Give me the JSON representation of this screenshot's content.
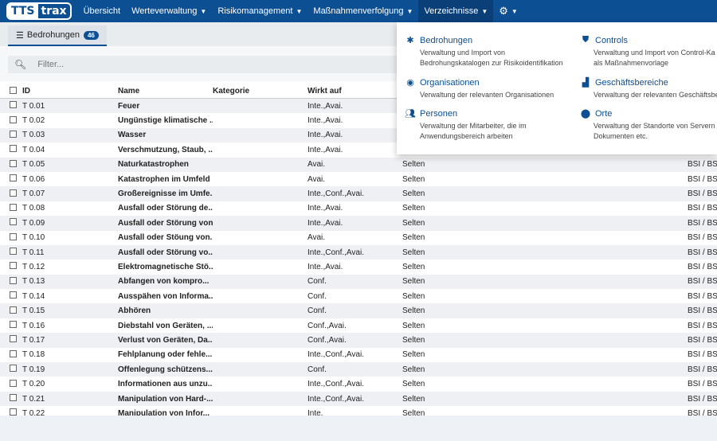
{
  "logo": {
    "part1": "TTS",
    "part2": "trax"
  },
  "nav": {
    "items": [
      {
        "label": "Übersicht",
        "caret": false
      },
      {
        "label": "Werteverwaltung",
        "caret": true
      },
      {
        "label": "Risikomanagement",
        "caret": true
      },
      {
        "label": "Maßnahmenverfolgung",
        "caret": true
      },
      {
        "label": "Verzeichnisse",
        "caret": true
      }
    ],
    "settings_icon": "gear-icon"
  },
  "tab": {
    "label": "Bedrohungen",
    "count": "46"
  },
  "filter": {
    "placeholder": "Filter..."
  },
  "table": {
    "headers": [
      "ID",
      "Name",
      "Kategorie",
      "Wirkt auf"
    ],
    "rows": [
      {
        "id": "T 0.01",
        "name": "Feuer",
        "wirkt": "Inte.,Avai.",
        "freq": "",
        "quelle": ""
      },
      {
        "id": "T 0.02",
        "name": "Ungünstige klimatische ...",
        "wirkt": "Inte.,Avai.",
        "freq": "",
        "quelle": ""
      },
      {
        "id": "T 0.03",
        "name": "Wasser",
        "wirkt": "Inte.,Avai.",
        "freq": "",
        "quelle": ""
      },
      {
        "id": "T 0.04",
        "name": "Verschmutzung, Staub, ...",
        "wirkt": "Inte.,Avai.",
        "freq": "",
        "quelle": ""
      },
      {
        "id": "T 0.05",
        "name": "Naturkatastrophen",
        "wirkt": "Avai.",
        "freq": "Selten",
        "quelle": "BSI / BSI"
      },
      {
        "id": "T 0.06",
        "name": "Katastrophen im Umfeld",
        "wirkt": "Avai.",
        "freq": "Selten",
        "quelle": "BSI / BSI"
      },
      {
        "id": "T 0.07",
        "name": "Großereignisse im Umfe...",
        "wirkt": "Inte.,Conf.,Avai.",
        "freq": "Selten",
        "quelle": "BSI / BSI"
      },
      {
        "id": "T 0.08",
        "name": "Ausfall oder Störung de...",
        "wirkt": "Inte.,Avai.",
        "freq": "Selten",
        "quelle": "BSI / BSI"
      },
      {
        "id": "T 0.09",
        "name": "Ausfall oder Störung von...",
        "wirkt": "Inte.,Avai.",
        "freq": "Selten",
        "quelle": "BSI / BSI"
      },
      {
        "id": "T 0.10",
        "name": "Ausfall oder Stöung von...",
        "wirkt": "Avai.",
        "freq": "Selten",
        "quelle": "BSI / BSI"
      },
      {
        "id": "T 0.11",
        "name": "Ausfall oder Störung vo...",
        "wirkt": "Inte.,Conf.,Avai.",
        "freq": "Selten",
        "quelle": "BSI / BSI"
      },
      {
        "id": "T 0.12",
        "name": "Elektromagnetische Stö...",
        "wirkt": "Inte.,Avai.",
        "freq": "Selten",
        "quelle": "BSI / BSI"
      },
      {
        "id": "T 0.13",
        "name": "Abfangen von kompro...",
        "wirkt": "Conf.",
        "freq": "Selten",
        "quelle": "BSI / BSI"
      },
      {
        "id": "T 0.14",
        "name": "Ausspähen von Informa...",
        "wirkt": "Conf.",
        "freq": "Selten",
        "quelle": "BSI / BSI"
      },
      {
        "id": "T 0.15",
        "name": "Abhören",
        "wirkt": "Conf.",
        "freq": "Selten",
        "quelle": "BSI / BSI"
      },
      {
        "id": "T 0.16",
        "name": "Diebstahl von Geräten, ...",
        "wirkt": "Conf.,Avai.",
        "freq": "Selten",
        "quelle": "BSI / BSI"
      },
      {
        "id": "T 0.17",
        "name": "Verlust von Geräten, Da...",
        "wirkt": "Conf.,Avai.",
        "freq": "Selten",
        "quelle": "BSI / BSI"
      },
      {
        "id": "T 0.18",
        "name": "Fehlplanung oder fehle...",
        "wirkt": "Inte.,Conf.,Avai.",
        "freq": "Selten",
        "quelle": "BSI / BSI"
      },
      {
        "id": "T 0.19",
        "name": "Offenlegung schützens...",
        "wirkt": "Conf.",
        "freq": "Selten",
        "quelle": "BSI / BSI"
      },
      {
        "id": "T 0.20",
        "name": "Informationen aus unzu...",
        "wirkt": "Inte.,Conf.,Avai.",
        "freq": "Selten",
        "quelle": "BSI / BSI"
      },
      {
        "id": "T 0.21",
        "name": "Manipulation von Hard-...",
        "wirkt": "Inte.,Conf.,Avai.",
        "freq": "Selten",
        "quelle": "BSI / BSI"
      },
      {
        "id": "T 0.22",
        "name": "Manipulation von Infor...",
        "wirkt": "Inte.",
        "freq": "Selten",
        "quelle": "BSI / BSI"
      }
    ]
  },
  "dropdown": {
    "items": [
      {
        "title": "Bedrohungen",
        "desc1": "Verwaltung und Import von",
        "desc2": "Bedrohungskatalogen zur Risikoidentifikation",
        "icon": "bug-icon"
      },
      {
        "title": "Controls",
        "desc1": "Verwaltung und Import von Control-Ka",
        "desc2": "als Maßnahmenvorlage",
        "icon": "shield-icon"
      },
      {
        "title": "Organisationen",
        "desc1": "Verwaltung der relevanten Organisationen",
        "desc2": "",
        "icon": "globe-icon"
      },
      {
        "title": "Geschäftsbereiche",
        "desc1": "Verwaltung der relevanten Geschäftsbe",
        "desc2": "",
        "icon": "factory-icon"
      },
      {
        "title": "Personen",
        "desc1": "Verwaltung der Mitarbeiter, die im",
        "desc2": "Anwendungsbereich arbeiten",
        "icon": "users-icon"
      },
      {
        "title": "Orte",
        "desc1": "Verwaltung der Standorte von Servern",
        "desc2": "Dokumenten etc.",
        "icon": "map-pin-icon"
      }
    ]
  },
  "colors": {
    "primary": "#0d4f93",
    "row_alt": "#eef0f3"
  }
}
